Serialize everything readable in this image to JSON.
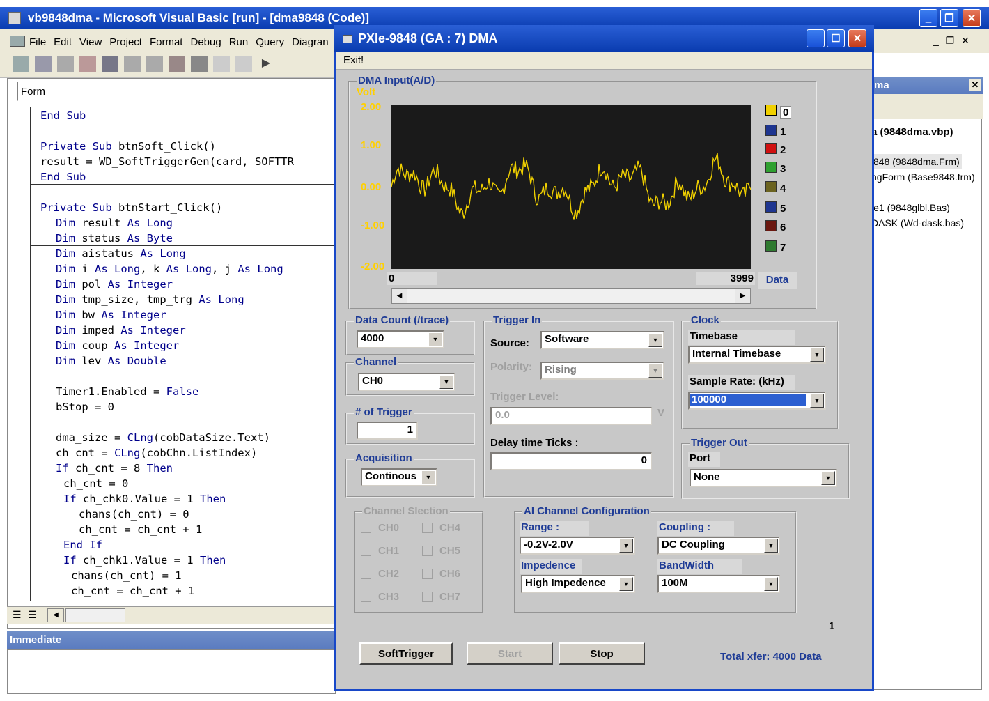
{
  "vb": {
    "title": "vb9848dma - Microsoft Visual Basic [run] - [dma9848 (Code)]",
    "menu": [
      "File",
      "Edit",
      "View",
      "Project",
      "Format",
      "Debug",
      "Run",
      "Query",
      "Diagran"
    ],
    "object_box": "Form",
    "code": [
      {
        "t": "End Sub",
        "ind": 0
      },
      {
        "t": "",
        "ind": 0
      },
      {
        "t": "Private Sub btnSoft_Click()",
        "ind": 0
      },
      {
        "t": "result = WD_SoftTriggerGen(card, SOFTTR",
        "ind": 0
      },
      {
        "t": "End Sub",
        "ind": 0
      },
      {
        "t": "",
        "ind": 0
      },
      {
        "t": "Private Sub btnStart_Click()",
        "ind": 0
      },
      {
        "t": "Dim result As Long",
        "ind": 1
      },
      {
        "t": "Dim status As Byte",
        "ind": 1
      },
      {
        "t": "Dim aistatus As Long",
        "ind": 1
      },
      {
        "t": "Dim i As Long, k As Long, j As Long",
        "ind": 1
      },
      {
        "t": "Dim pol As Integer",
        "ind": 1
      },
      {
        "t": "Dim tmp_size, tmp_trg As Long",
        "ind": 1
      },
      {
        "t": "Dim bw As Integer",
        "ind": 1
      },
      {
        "t": "Dim imped As Integer",
        "ind": 1
      },
      {
        "t": "Dim coup As Integer",
        "ind": 1
      },
      {
        "t": "Dim lev As Double",
        "ind": 1
      },
      {
        "t": "",
        "ind": 0
      },
      {
        "t": "Timer1.Enabled = False",
        "ind": 1
      },
      {
        "t": "bStop = 0",
        "ind": 1
      },
      {
        "t": "",
        "ind": 0
      },
      {
        "t": "dma_size = CLng(cobDataSize.Text)",
        "ind": 1
      },
      {
        "t": "ch_cnt = CLng(cobChn.ListIndex)",
        "ind": 1
      },
      {
        "t": "If ch_cnt = 8 Then",
        "ind": 1
      },
      {
        "t": "ch_cnt = 0",
        "ind": 2
      },
      {
        "t": "If ch_chk0.Value = 1 Then",
        "ind": 2
      },
      {
        "t": "chans(ch_cnt) = 0",
        "ind": 3
      },
      {
        "t": "ch_cnt = ch_cnt + 1",
        "ind": 3
      },
      {
        "t": "End If",
        "ind": 2
      },
      {
        "t": "If ch_chk1.Value = 1 Then",
        "ind": 2
      },
      {
        "t": "chans(ch_cnt) = 1",
        "ind": 4
      },
      {
        "t": "ch_cnt = ch_cnt + 1",
        "ind": 4
      }
    ],
    "immediate": "Immediate",
    "project_title": "ma",
    "project_items": [
      "a (9848dma.vbp)",
      "848 (9848dma.Frm)",
      "ngForm (Base9848.frm)",
      "le1 (9848glbl.Bas)",
      "DASK (Wd-dask.bas)"
    ]
  },
  "dlg": {
    "title": "PXIe-9848 (GA : 7) DMA",
    "menu_exit": "Exit!",
    "dma_group": "DMA Input(A/D)",
    "volt": "Volt",
    "yticks": [
      "2.00",
      "1.00",
      "0.00",
      "-1.00",
      "-2.00"
    ],
    "x_start": "0",
    "x_end": "3999",
    "x_label": "Data",
    "legend": [
      {
        "n": "0",
        "c": "#f0d000"
      },
      {
        "n": "1",
        "c": "#1e3590"
      },
      {
        "n": "2",
        "c": "#d01010"
      },
      {
        "n": "3",
        "c": "#2fa030"
      },
      {
        "n": "4",
        "c": "#6b6320"
      },
      {
        "n": "5",
        "c": "#1e3590"
      },
      {
        "n": "6",
        "c": "#6b1810"
      },
      {
        "n": "7",
        "c": "#2f7a30"
      }
    ],
    "data_count_group": "Data Count (/trace)",
    "data_count": "4000",
    "channel_group": "Channel",
    "channel": "CH0",
    "trig_num_group": "# of Trigger",
    "trig_num": "1",
    "acq_group": "Acquisition",
    "acq": "Continous",
    "trig_in_group": "Trigger In",
    "source_lbl": "Source:",
    "source": "Software",
    "polarity_lbl": "Polarity:",
    "polarity": "Rising",
    "level_lbl": "Trigger Level:",
    "level": "0.0",
    "level_unit": "V",
    "delay_lbl": "Delay time Ticks :",
    "delay": "0",
    "clock_group": "Clock",
    "timebase_lbl": "Timebase",
    "timebase": "Internal Timebase",
    "rate_lbl": "Sample Rate: (kHz)",
    "rate": "100000",
    "trig_out_group": "Trigger Out",
    "port_lbl": "Port",
    "port": "None",
    "ch_sel_group": "Channel Slection",
    "chs": [
      "CH0",
      "CH1",
      "CH2",
      "CH3",
      "CH4",
      "CH5",
      "CH6",
      "CH7"
    ],
    "aicfg_group": "AI Channel Configuration",
    "range_lbl": "Range :",
    "range": "-0.2V-2.0V",
    "coup_lbl": "Coupling :",
    "coup": "DC Coupling",
    "imp_lbl": "Impedence",
    "imp": "High Impedence",
    "bw_lbl": "BandWidth",
    "bw": "100M",
    "counter": "1",
    "btn_soft": "SoftTrigger",
    "btn_start": "Start",
    "btn_stop": "Stop",
    "total": "Total xfer: 4000 Data"
  }
}
